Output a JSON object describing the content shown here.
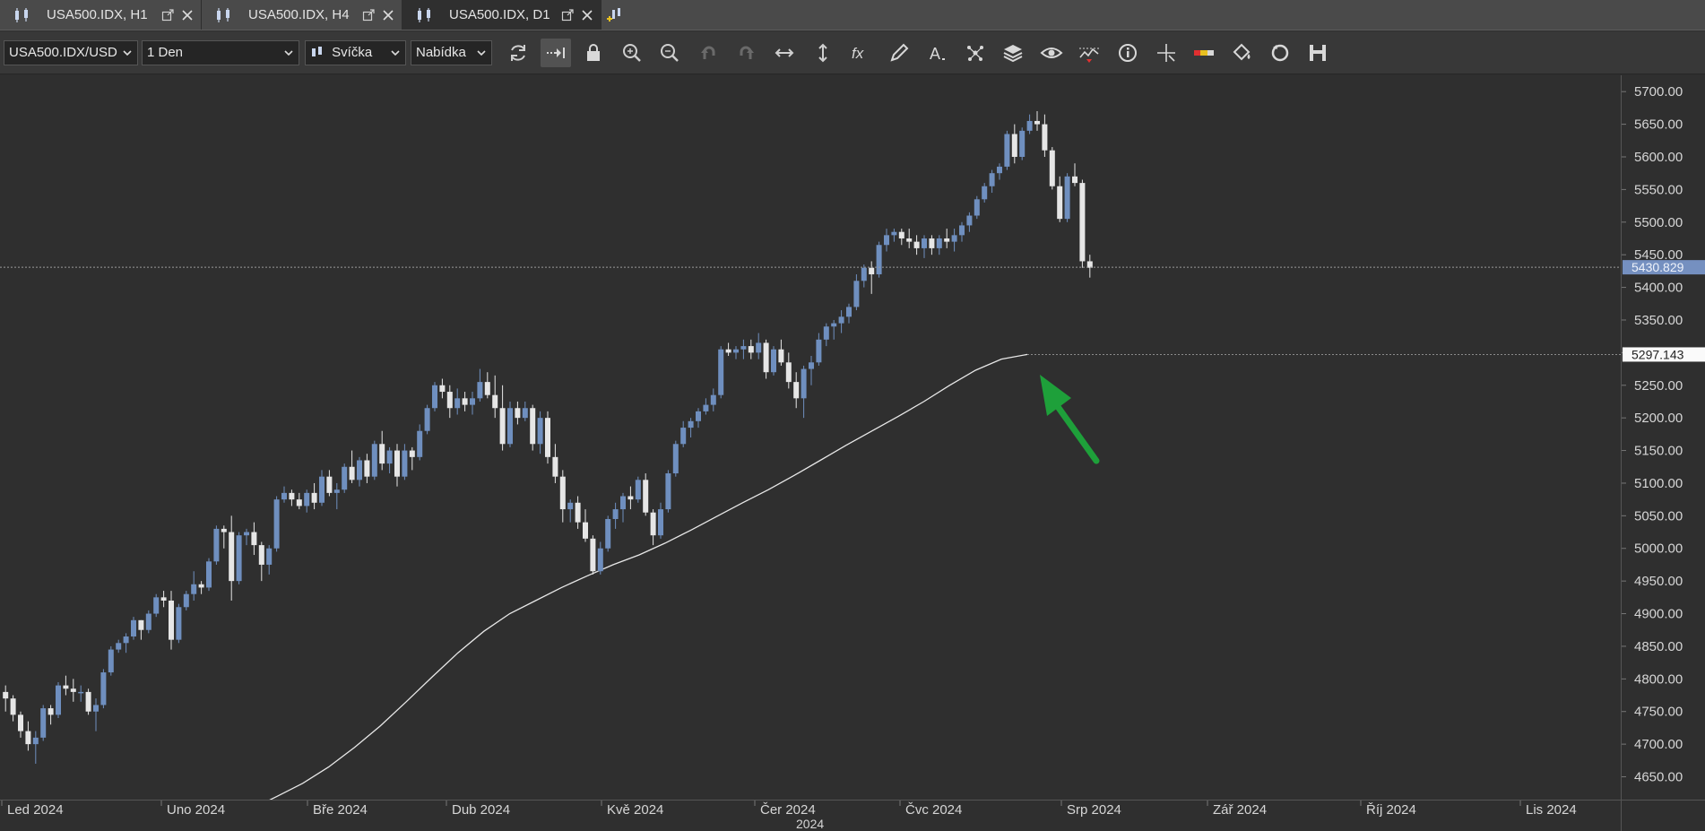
{
  "tabs": [
    {
      "label": "USA500.IDX, H1",
      "active": false
    },
    {
      "label": "USA500.IDX, H4",
      "active": false
    },
    {
      "label": "USA500.IDX, D1",
      "active": true
    }
  ],
  "toolbar": {
    "instrument": "USA500.IDX/USD",
    "period": "1 Den",
    "chart_type": "Svíčka",
    "offer_side": "Nabídka",
    "icons": [
      "refresh-icon",
      "autoshift-icon",
      "lock-icon",
      "zoom-in-icon",
      "zoom-out-icon",
      "undo-icon",
      "redo-icon",
      "horizontal-resize-icon",
      "vertical-resize-icon",
      "indicators-fx-icon",
      "drawing-pencil-icon",
      "text-tool-icon",
      "patterns-icon",
      "layers-icon",
      "visibility-eye-icon",
      "alerts-icon",
      "info-icon",
      "crosshair-icon",
      "theme-colors-icon",
      "paint-bucket-icon",
      "reset-icon",
      "save-icon"
    ],
    "active_icon": "autoshift-icon"
  },
  "colors": {
    "background": "#2f2f2f",
    "bull_candle": "#6f8fbf",
    "bear_candle": "#e6e6e6",
    "moving_average": "#e8e8e8",
    "arrow": "#1ea03a",
    "price_marker": "#7590c0"
  },
  "chart_data": {
    "type": "candlestick",
    "instrument": "USA500.IDX",
    "timeframe": "D1",
    "ylim": [
      4615,
      5725
    ],
    "yticks": [
      4650,
      4700,
      4750,
      4800,
      4850,
      4900,
      4950,
      5000,
      5050,
      5100,
      5150,
      5200,
      5250,
      5300,
      5350,
      5400,
      5450,
      5500,
      5550,
      5600,
      5650,
      5700
    ],
    "ytick_labels": [
      "4650.00",
      "4700.00",
      "4750.00",
      "4800.00",
      "4850.00",
      "4900.00",
      "4950.00",
      "5000.00",
      "5050.00",
      "5100.00",
      "5150.00",
      "5200.00",
      "5250.00",
      "5300.00",
      "5350.00",
      "5400.00",
      "5450.00",
      "5500.00",
      "5550.00",
      "5600.00",
      "5650.00",
      "5700.00"
    ],
    "xticks": [
      "Led 2024",
      "Uno 2024",
      "Bře 2024",
      "Dub 2024",
      "Kvě 2024",
      "Čer 2024",
      "Čvc 2024",
      "Srp 2024",
      "Zář 2024",
      "Říj 2024",
      "Lis 2024"
    ],
    "x_axis_year": "2024",
    "current_price": 5430.829,
    "current_price_label": "5430.829",
    "ma_last_value": 5297.143,
    "ma_label": "5297.143",
    "ma_series": [
      4600,
      4620,
      4640,
      4665,
      4695,
      4728,
      4765,
      4803,
      4840,
      4873,
      4900,
      4920,
      4940,
      4958,
      4975,
      4990,
      5008,
      5028,
      5049,
      5070,
      5090,
      5112,
      5135,
      5158,
      5180,
      5202,
      5225,
      5250,
      5273,
      5290,
      5297.143
    ],
    "candles": [
      [
        4780,
        4790,
        4750,
        4770
      ],
      [
        4770,
        4775,
        4735,
        4745
      ],
      [
        4745,
        4750,
        4710,
        4720
      ],
      [
        4720,
        4735,
        4690,
        4700
      ],
      [
        4700,
        4720,
        4670,
        4710
      ],
      [
        4710,
        4760,
        4705,
        4755
      ],
      [
        4755,
        4760,
        4730,
        4745
      ],
      [
        4745,
        4795,
        4740,
        4790
      ],
      [
        4790,
        4805,
        4775,
        4785
      ],
      [
        4785,
        4800,
        4765,
        4780
      ],
      [
        4780,
        4790,
        4765,
        4780
      ],
      [
        4780,
        4785,
        4745,
        4750
      ],
      [
        4750,
        4770,
        4720,
        4760
      ],
      [
        4760,
        4815,
        4755,
        4810
      ],
      [
        4810,
        4850,
        4805,
        4845
      ],
      [
        4845,
        4860,
        4840,
        4855
      ],
      [
        4855,
        4870,
        4840,
        4865
      ],
      [
        4865,
        4895,
        4860,
        4890
      ],
      [
        4890,
        4890,
        4860,
        4875
      ],
      [
        4875,
        4905,
        4870,
        4900
      ],
      [
        4900,
        4930,
        4895,
        4925
      ],
      [
        4925,
        4935,
        4910,
        4920
      ],
      [
        4920,
        4935,
        4845,
        4860
      ],
      [
        4860,
        4915,
        4855,
        4910
      ],
      [
        4910,
        4935,
        4905,
        4930
      ],
      [
        4930,
        4965,
        4920,
        4945
      ],
      [
        4945,
        4950,
        4930,
        4940
      ],
      [
        4940,
        4985,
        4935,
        4980
      ],
      [
        4980,
        5035,
        4975,
        5030
      ],
      [
        5030,
        5035,
        5000,
        5025
      ],
      [
        5025,
        5050,
        4920,
        4950
      ],
      [
        4950,
        5025,
        4945,
        5020
      ],
      [
        5020,
        5030,
        5005,
        5025
      ],
      [
        5025,
        5040,
        4990,
        5005
      ],
      [
        5005,
        5010,
        4950,
        4975
      ],
      [
        4975,
        5005,
        4960,
        5000
      ],
      [
        5000,
        5080,
        4995,
        5075
      ],
      [
        5075,
        5095,
        5070,
        5085
      ],
      [
        5085,
        5090,
        5065,
        5075
      ],
      [
        5075,
        5085,
        5060,
        5065
      ],
      [
        5065,
        5090,
        5055,
        5085
      ],
      [
        5085,
        5100,
        5060,
        5070
      ],
      [
        5070,
        5120,
        5065,
        5110
      ],
      [
        5110,
        5120,
        5080,
        5085
      ],
      [
        5085,
        5100,
        5060,
        5090
      ],
      [
        5090,
        5130,
        5085,
        5125
      ],
      [
        5125,
        5150,
        5100,
        5105
      ],
      [
        5105,
        5140,
        5095,
        5135
      ],
      [
        5135,
        5145,
        5100,
        5110
      ],
      [
        5110,
        5165,
        5105,
        5160
      ],
      [
        5160,
        5180,
        5120,
        5130
      ],
      [
        5130,
        5155,
        5115,
        5150
      ],
      [
        5150,
        5160,
        5095,
        5110
      ],
      [
        5110,
        5160,
        5105,
        5150
      ],
      [
        5150,
        5155,
        5120,
        5140
      ],
      [
        5140,
        5190,
        5135,
        5180
      ],
      [
        5180,
        5220,
        5175,
        5215
      ],
      [
        5215,
        5255,
        5210,
        5250
      ],
      [
        5250,
        5260,
        5230,
        5240
      ],
      [
        5240,
        5250,
        5200,
        5215
      ],
      [
        5215,
        5245,
        5205,
        5230
      ],
      [
        5230,
        5240,
        5210,
        5220
      ],
      [
        5220,
        5240,
        5205,
        5230
      ],
      [
        5230,
        5275,
        5225,
        5255
      ],
      [
        5255,
        5270,
        5230,
        5235
      ],
      [
        5235,
        5265,
        5200,
        5215
      ],
      [
        5215,
        5250,
        5150,
        5160
      ],
      [
        5160,
        5225,
        5155,
        5215
      ],
      [
        5215,
        5225,
        5190,
        5200
      ],
      [
        5200,
        5225,
        5195,
        5215
      ],
      [
        5215,
        5220,
        5150,
        5160
      ],
      [
        5160,
        5210,
        5145,
        5200
      ],
      [
        5200,
        5210,
        5130,
        5140
      ],
      [
        5140,
        5160,
        5100,
        5110
      ],
      [
        5110,
        5120,
        5040,
        5060
      ],
      [
        5060,
        5075,
        5040,
        5070
      ],
      [
        5070,
        5080,
        5030,
        5040
      ],
      [
        5040,
        5060,
        5010,
        5015
      ],
      [
        5015,
        5020,
        4960,
        4965
      ],
      [
        4965,
        5010,
        4960,
        5000
      ],
      [
        5000,
        5050,
        4995,
        5045
      ],
      [
        5045,
        5070,
        5030,
        5060
      ],
      [
        5060,
        5085,
        5040,
        5080
      ],
      [
        5080,
        5095,
        5060,
        5075
      ],
      [
        5075,
        5110,
        5070,
        5105
      ],
      [
        5105,
        5115,
        5050,
        5055
      ],
      [
        5055,
        5060,
        5005,
        5020
      ],
      [
        5020,
        5070,
        5015,
        5060
      ],
      [
        5060,
        5120,
        5055,
        5115
      ],
      [
        5115,
        5165,
        5110,
        5160
      ],
      [
        5160,
        5195,
        5155,
        5185
      ],
      [
        5185,
        5200,
        5170,
        5195
      ],
      [
        5195,
        5215,
        5185,
        5210
      ],
      [
        5210,
        5230,
        5205,
        5220
      ],
      [
        5220,
        5245,
        5210,
        5235
      ],
      [
        5235,
        5310,
        5230,
        5305
      ],
      [
        5305,
        5315,
        5295,
        5300
      ],
      [
        5300,
        5310,
        5290,
        5305
      ],
      [
        5305,
        5320,
        5290,
        5310
      ],
      [
        5310,
        5320,
        5290,
        5300
      ],
      [
        5300,
        5330,
        5290,
        5315
      ],
      [
        5315,
        5320,
        5260,
        5270
      ],
      [
        5270,
        5310,
        5265,
        5305
      ],
      [
        5305,
        5320,
        5280,
        5285
      ],
      [
        5285,
        5300,
        5245,
        5255
      ],
      [
        5255,
        5270,
        5215,
        5230
      ],
      [
        5230,
        5280,
        5200,
        5275
      ],
      [
        5275,
        5295,
        5250,
        5285
      ],
      [
        5285,
        5330,
        5280,
        5320
      ],
      [
        5320,
        5345,
        5310,
        5340
      ],
      [
        5340,
        5350,
        5320,
        5345
      ],
      [
        5345,
        5365,
        5330,
        5355
      ],
      [
        5355,
        5375,
        5345,
        5370
      ],
      [
        5370,
        5420,
        5365,
        5410
      ],
      [
        5410,
        5435,
        5400,
        5430
      ],
      [
        5430,
        5440,
        5390,
        5420
      ],
      [
        5420,
        5470,
        5415,
        5465
      ],
      [
        5465,
        5490,
        5455,
        5480
      ],
      [
        5480,
        5490,
        5470,
        5485
      ],
      [
        5485,
        5490,
        5465,
        5475
      ],
      [
        5475,
        5490,
        5460,
        5470
      ],
      [
        5470,
        5480,
        5450,
        5460
      ],
      [
        5460,
        5480,
        5445,
        5475
      ],
      [
        5475,
        5480,
        5450,
        5460
      ],
      [
        5460,
        5480,
        5450,
        5475
      ],
      [
        5475,
        5490,
        5460,
        5470
      ],
      [
        5470,
        5490,
        5455,
        5480
      ],
      [
        5480,
        5500,
        5470,
        5495
      ],
      [
        5495,
        5515,
        5485,
        5510
      ],
      [
        5510,
        5540,
        5505,
        5535
      ],
      [
        5535,
        5560,
        5530,
        5555
      ],
      [
        5555,
        5580,
        5545,
        5575
      ],
      [
        5575,
        5590,
        5565,
        5585
      ],
      [
        5585,
        5640,
        5580,
        5635
      ],
      [
        5635,
        5650,
        5590,
        5600
      ],
      [
        5600,
        5645,
        5595,
        5640
      ],
      [
        5640,
        5665,
        5635,
        5655
      ],
      [
        5655,
        5670,
        5640,
        5650
      ],
      [
        5650,
        5665,
        5600,
        5610
      ],
      [
        5610,
        5615,
        5550,
        5555
      ],
      [
        5555,
        5570,
        5500,
        5505
      ],
      [
        5505,
        5575,
        5500,
        5570
      ],
      [
        5570,
        5590,
        5555,
        5560
      ],
      [
        5560,
        5565,
        5430,
        5440
      ],
      [
        5440,
        5450,
        5415,
        5430
      ]
    ]
  }
}
